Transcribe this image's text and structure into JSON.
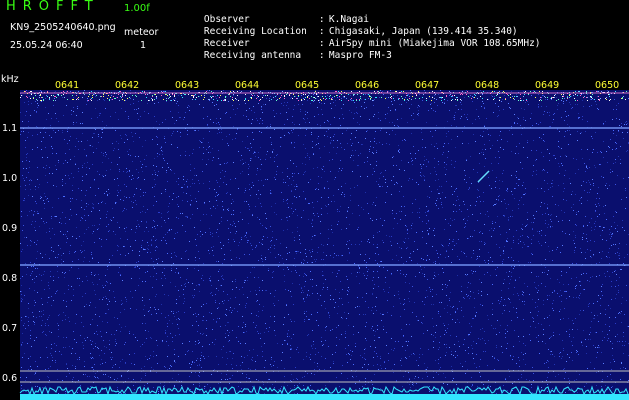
{
  "header": {
    "app_title": "HROFFT",
    "version": "1.00f",
    "filename": "KN9_2505240640.png",
    "datetime": "25.05.24 06:40",
    "meteor_label": "meteor",
    "meteor_count": "1"
  },
  "station": [
    {
      "key": "Observer",
      "value": "K.Nagai"
    },
    {
      "key": "Receiving Location",
      "value": "Chigasaki, Japan (139.414 35.340)"
    },
    {
      "key": "Receiver",
      "value": "AirSpy mini (Miakejima VOR 108.65MHz)"
    },
    {
      "key": "Receiving antenna",
      "value": "Maspro FM-3"
    }
  ],
  "separator": ":",
  "axis": {
    "unit": "kHz",
    "y_ticks": [
      "1.1",
      "1.0",
      "0.9",
      "0.8",
      "0.7",
      "0.6"
    ],
    "x_ticks": [
      "0641",
      "0642",
      "0643",
      "0644",
      "0645",
      "0646",
      "0647",
      "0648",
      "0649",
      "0650"
    ]
  },
  "colors": {
    "background": "#000000",
    "plot_bg": "#0a0f6e",
    "header_green": "#39ff14",
    "tick_yellow": "#ffff33",
    "signal_cyan": "#33e6ff"
  }
}
